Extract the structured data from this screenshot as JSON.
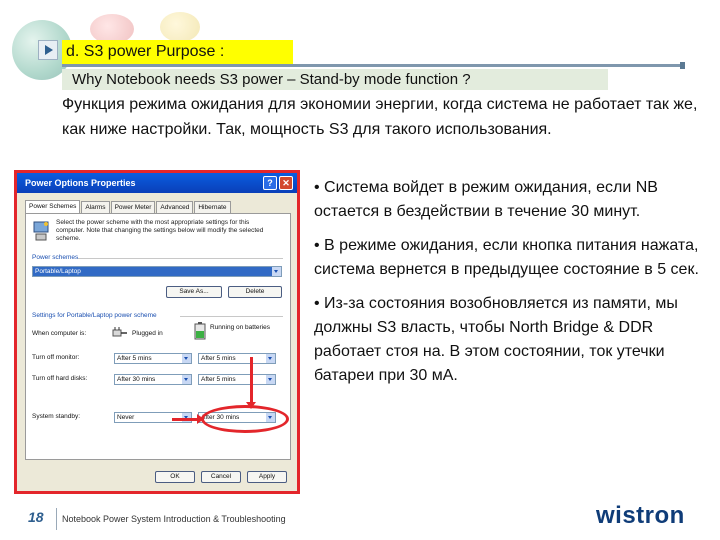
{
  "slide": {
    "label_d": "d.  S3 power Purpose  :",
    "label_why": "Why Notebook needs S3 power – Stand-by mode function ?",
    "intro": "Функция режима ожидания для экономии энергии, когда система не работает так же, как ниже настройки. Так, мощность S3 для такого использования.",
    "bullets": [
      "• Система войдет в режим ожидания, если NB остается в бездействии в течение 30 минут.",
      "• В режиме ожидания, если кнопка питания нажата, система вернется в предыдущее состояние в 5 сек.",
      "• Из-за состояния возобновляется из памяти, мы должны S3 власть, чтобы North Bridge & DDR работает стоя на. В этом состоянии, ток утечки батареи при 30 мА."
    ],
    "page_number": "18",
    "footer_text": "Notebook Power System Introduction & Troubleshooting",
    "logo_text": "wistron"
  },
  "dialog": {
    "title": "Power Options Properties",
    "help_glyph": "?",
    "close_glyph": "✕",
    "tabs": [
      "Power Schemes",
      "Alarms",
      "Power Meter",
      "Advanced",
      "Hibernate"
    ],
    "description": "Select the power scheme with the most appropriate settings for this computer. Note that changing the settings below will modify the selected scheme.",
    "scheme_group_label": "Power schemes",
    "scheme_selected": "Portable/Laptop",
    "save_as_label": "Save As...",
    "delete_label": "Delete",
    "settings_group_label": "Settings for Portable/Laptop power scheme",
    "when_computer_is": "When computer is:",
    "plugged_in": "Plugged in",
    "running_on_batteries": "Running on batteries",
    "rows": [
      {
        "label": "Turn off monitor:",
        "plugged": "After 5 mins",
        "battery": "After 5 mins"
      },
      {
        "label": "Turn off hard disks:",
        "plugged": "After 30 mins",
        "battery": "After 5 mins"
      },
      {
        "label": "System standby:",
        "plugged": "Never",
        "battery": "After 30 mins"
      }
    ],
    "ok_label": "OK",
    "cancel_label": "Cancel",
    "apply_label": "Apply"
  },
  "colors": {
    "highlight_yellow": "#ffff00",
    "annotation_red": "#e3262b",
    "logo_blue": "#0f3c78"
  }
}
